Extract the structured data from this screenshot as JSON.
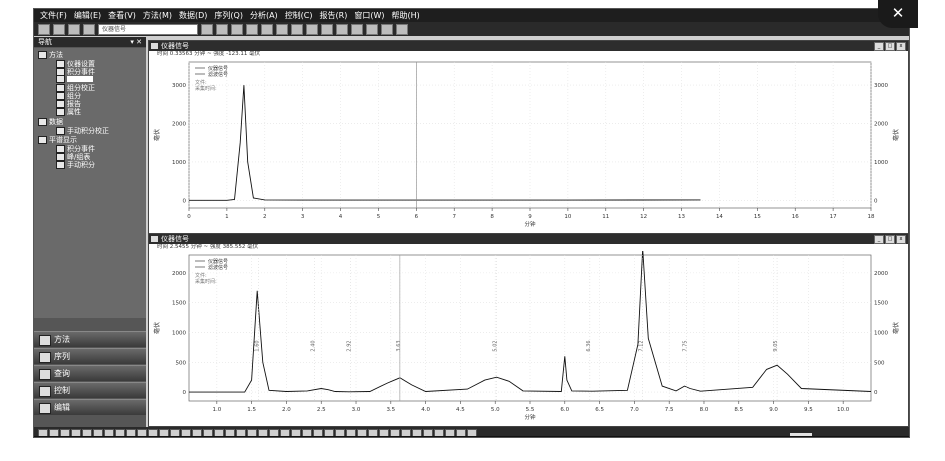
{
  "menu": [
    "文件(F)",
    "编辑(E)",
    "查看(V)",
    "方法(M)",
    "数据(D)",
    "序列(Q)",
    "分析(A)",
    "控制(C)",
    "报告(R)",
    "窗口(W)",
    "帮助(H)"
  ],
  "toolbar": {
    "combo_value": "仪器信号"
  },
  "sidebar": {
    "title": "导航",
    "tree": [
      {
        "label": "方法",
        "level": 0
      },
      {
        "label": "仪器设置",
        "level": 2
      },
      {
        "label": "积分事件",
        "level": 2
      },
      {
        "label": "",
        "level": 2,
        "selected": true
      },
      {
        "label": "组分校正",
        "level": 2
      },
      {
        "label": "组分",
        "level": 2
      },
      {
        "label": "报告",
        "level": 2
      },
      {
        "label": "属性",
        "level": 2
      },
      {
        "label": "数据",
        "level": 0
      },
      {
        "label": "手动积分校正",
        "level": 2
      },
      {
        "label": "平谱显示",
        "level": 0
      },
      {
        "label": "积分事件",
        "level": 2
      },
      {
        "label": "峰/组表",
        "level": 2
      },
      {
        "label": "手动积分",
        "level": 2
      }
    ],
    "nav_buttons": [
      "方法",
      "序列",
      "查询",
      "控制",
      "编辑"
    ]
  },
  "panes": [
    {
      "title": "仪器信号",
      "info": "时间  0.33563 分钟 ~ 强度  -123.11 毫伏",
      "legend": [
        "仪器信号",
        "滤波信号"
      ],
      "legend2": [
        "文件:",
        "采集时间:"
      ],
      "ylabel": "毫伏",
      "xlabel": "分钟",
      "x_ticks": [
        "0",
        "1",
        "2",
        "3",
        "4",
        "5",
        "6",
        "7",
        "8",
        "9",
        "10",
        "11",
        "12",
        "13",
        "14",
        "15",
        "16",
        "17",
        "18"
      ],
      "y_ticks": [
        "0",
        "1000",
        "2000",
        "3000"
      ]
    },
    {
      "title": "仪器信号",
      "info": "时间  2.5455 分钟 ~ 强度  385.552 毫伏",
      "legend": [
        "仪器信号",
        "滤波信号"
      ],
      "legend2": [
        "文件:",
        "采集时间:"
      ],
      "ylabel": "毫伏",
      "xlabel": "分钟",
      "x_ticks": [
        "1.0",
        "1.5",
        "2.0",
        "2.5",
        "3.0",
        "3.5",
        "4.0",
        "4.5",
        "5.0",
        "5.5",
        "6.0",
        "6.5",
        "7.0",
        "7.5",
        "8.0",
        "8.5",
        "9.0",
        "9.5",
        "10.0"
      ],
      "y_ticks": [
        "0",
        "500",
        "1000",
        "1500",
        "2000"
      ],
      "peak_labels": [
        "1.60",
        "2.40",
        "2.92",
        "3.63",
        "5.02",
        "6.36",
        "7.12",
        "7.75",
        "9.05"
      ]
    }
  ],
  "chart_data": [
    {
      "type": "line",
      "title": "",
      "xlabel": "分钟",
      "ylabel": "毫伏",
      "xlim": [
        0,
        18
      ],
      "ylim": [
        -200,
        3600
      ],
      "series": [
        {
          "name": "仪器信号",
          "x": [
            0,
            1.0,
            1.2,
            1.35,
            1.45,
            1.55,
            1.7,
            2.0,
            3.0,
            6.0,
            10.0,
            13.5
          ],
          "y": [
            0,
            0,
            20,
            1500,
            3000,
            1000,
            60,
            10,
            5,
            5,
            5,
            10
          ]
        }
      ]
    },
    {
      "type": "line",
      "title": "",
      "xlabel": "分钟",
      "ylabel": "毫伏",
      "xlim": [
        0.6,
        10.4
      ],
      "ylim": [
        -150,
        2300
      ],
      "series": [
        {
          "name": "仪器信号",
          "x": [
            0.6,
            1.4,
            1.5,
            1.58,
            1.66,
            1.75,
            2.0,
            2.3,
            2.5,
            2.6,
            2.7,
            2.9,
            3.2,
            3.45,
            3.63,
            3.8,
            4.0,
            4.6,
            4.85,
            5.02,
            5.2,
            5.4,
            5.95,
            6.0,
            6.03,
            6.1,
            6.4,
            6.9,
            7.05,
            7.12,
            7.2,
            7.4,
            7.6,
            7.72,
            7.8,
            7.95,
            8.7,
            8.9,
            9.05,
            9.2,
            9.4,
            10.4
          ],
          "y": [
            0,
            0,
            200,
            1700,
            500,
            30,
            10,
            20,
            60,
            40,
            10,
            5,
            10,
            150,
            240,
            120,
            10,
            50,
            200,
            250,
            180,
            20,
            10,
            600,
            200,
            20,
            15,
            30,
            800,
            2400,
            900,
            100,
            20,
            100,
            60,
            15,
            80,
            380,
            450,
            300,
            60,
            10
          ]
        }
      ]
    }
  ]
}
